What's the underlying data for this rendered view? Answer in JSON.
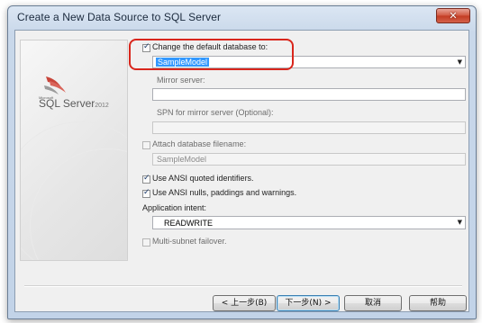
{
  "window": {
    "title": "Create a New Data Source to SQL Server",
    "close_glyph": "✕"
  },
  "logo": {
    "maker": "Microsoft",
    "product": "SQL Server",
    "version": "2012",
    "icon": "sql-server-logo-icon"
  },
  "form": {
    "default_db": {
      "label": "Change the default database to:",
      "checked": true,
      "value": "SampleModel"
    },
    "mirror_server": {
      "label": "Mirror server:",
      "value": ""
    },
    "spn_mirror": {
      "label": "SPN for mirror server (Optional):",
      "value": ""
    },
    "attach_db": {
      "label": "Attach database filename:",
      "checked": false,
      "value": "SampleModel"
    },
    "ansi_quoted": {
      "label": "Use ANSI quoted identifiers.",
      "checked": true
    },
    "ansi_nulls": {
      "label": "Use ANSI nulls, paddings and warnings.",
      "checked": true
    },
    "app_intent": {
      "label": "Application intent:",
      "value": "READWRITE"
    },
    "multi_subnet": {
      "label": "Multi-subnet failover.",
      "checked": false
    }
  },
  "buttons": {
    "back": "< 上一步(B)",
    "next": "下一步(N) >",
    "cancel": "取消",
    "help": "帮助"
  },
  "colors": {
    "highlight": "#d9261c",
    "selection": "#3399ff"
  }
}
